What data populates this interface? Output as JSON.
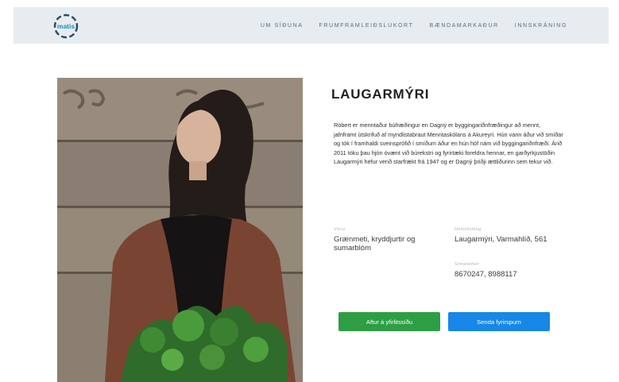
{
  "header": {
    "logo_text": "matis",
    "nav": [
      "UM SÍÐUNA",
      "FRUMFRAMLEIÐSLUKORT",
      "BÆNDAMARKAÐUR",
      "INNSKRÁNING"
    ]
  },
  "profile": {
    "name": "LAUGARMÝRI",
    "description": "Róbert er menntaður búfræðingur en Dagný er byggingariðnfræðingur að mennt, jafnframt útskrifuð af myndlistabraut Menntaskólans á Akureyri. Hún vann áður við smíðar og tók í framhaldi sveinsprófið í smíðum áður en hún hóf nám við byggingariðnfræði. Árið 2011 tóku þau hjón óvænt við búrekstri og fyrirtæki foreldra hennar, en garðyrkjustöðin Laugarmýri hefur verið starfrækt frá 1947 og er Dagný þriðji ættliðurinn sem tekur við.",
    "products_label": "Vörur",
    "products": "Grænmeti, kryddjurtir og sumarblóm",
    "address_label": "Heimilisfang",
    "address": "Laugarmýri, Varmahlíð, 561",
    "phone_label": "Símanúmer",
    "phone": "8670247, 8988117"
  },
  "actions": {
    "back_label": "Aftur á yfirlitssíðu",
    "inquiry_label": "Senda fyrirspurn"
  },
  "colors": {
    "nav_bg": "#e7ecf0",
    "green_button": "#2e9e45",
    "blue_button": "#1787e8",
    "logo_accent": "#1d8cc1"
  }
}
